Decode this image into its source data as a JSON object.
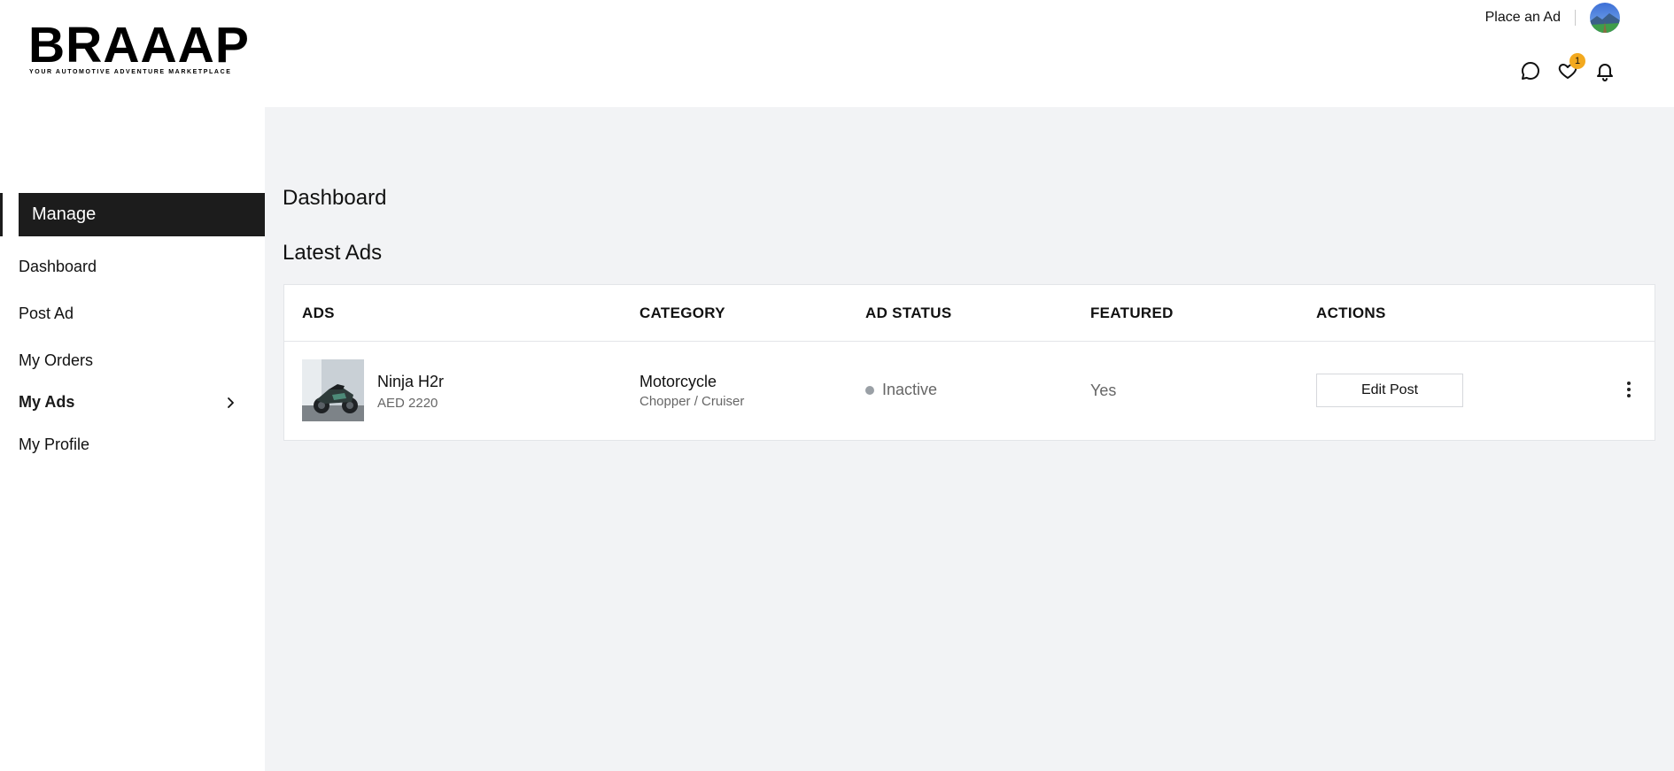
{
  "header": {
    "logo_main": "BRAAAP",
    "logo_sub": "YOUR AUTOMOTIVE ADVENTURE MARKETPLACE",
    "place_ad": "Place an Ad",
    "favorites_count": "1"
  },
  "sidebar": {
    "manage_label": "Manage",
    "items": [
      {
        "label": "Dashboard"
      },
      {
        "label": "Post Ad"
      },
      {
        "label": "My Orders"
      },
      {
        "label": "My Ads"
      },
      {
        "label": "My Profile"
      }
    ]
  },
  "main": {
    "page_title": "Dashboard",
    "section_title": "Latest Ads",
    "table": {
      "headers": [
        "ADS",
        "CATEGORY",
        "AD STATUS",
        "FEATURED",
        "ACTIONS"
      ],
      "rows": [
        {
          "name": "Ninja H2r",
          "price": "AED 2220",
          "category": "Motorcycle",
          "subcategory": "Chopper / Cruiser",
          "status": "Inactive",
          "featured": "Yes",
          "action": "Edit Post"
        }
      ]
    }
  },
  "icons": {
    "chat": "chat-icon",
    "favorites": "heart-icon",
    "notifications": "bell-icon",
    "expand": "chevron-right-icon",
    "more": "kebab-menu-icon"
  },
  "colors": {
    "badge": "#f3a91e",
    "manage_bg": "#1c1c1c",
    "main_bg": "#f2f3f5",
    "status_dot": "#9aa0a6"
  }
}
